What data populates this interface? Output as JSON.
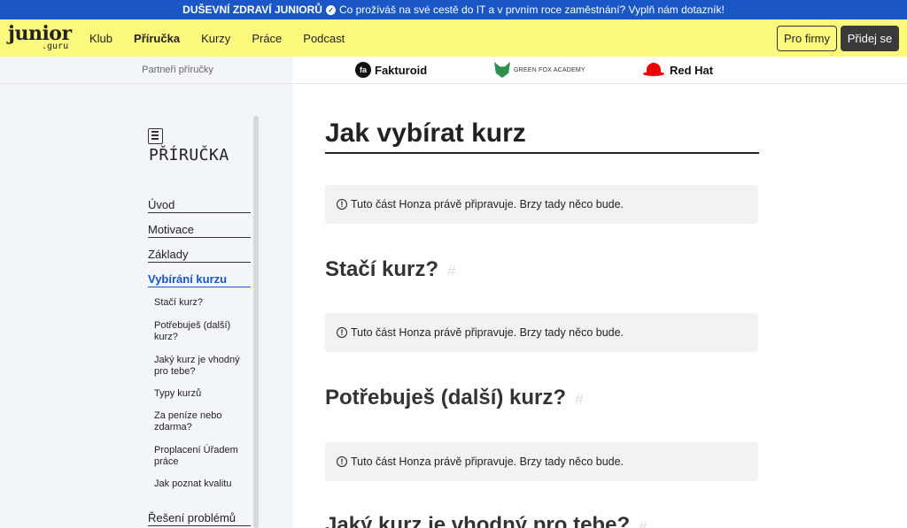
{
  "banner": {
    "bold": "DUŠEVNÍ ZDRAVÍ JUNIORŮ",
    "text": "Co prožíváš na své cestě do IT a v prvním roce zaměstnání? Vyplň nám dotazník!"
  },
  "logo": {
    "line1": "junior",
    "line2": ".guru"
  },
  "nav": {
    "items": [
      "Klub",
      "Příručka",
      "Kurzy",
      "Práce",
      "Podcast"
    ],
    "for_companies": "Pro firmy",
    "join": "Přidej se"
  },
  "partners": {
    "label": "Partneři příručky",
    "fakturoid": "Fakturoid",
    "fakturoid_mark": "fa",
    "greenfox": "GREEN FOX ACADEMY",
    "redhat": "Red Hat"
  },
  "sidebar": {
    "title": "PŘÍRUČKA",
    "items": [
      "Úvod",
      "Motivace",
      "Základy",
      "Vybírání kurzu"
    ],
    "subitems": [
      "Stačí kurz?",
      "Potřebuješ (další) kurz?",
      "Jaký kurz je vhodný pro tebe?",
      "Typy kurzů",
      "Za peníze nebo zdarma?",
      "Proplacení Úřadem práce",
      "Jak poznat kvalitu"
    ],
    "last_item": "Řešení problémů"
  },
  "main": {
    "title": "Jak vybírat kurz",
    "notice": "Tuto část Honza právě připravuje. Brzy tady něco bude.",
    "sections": [
      "Stačí kurz?",
      "Potřebuješ (další) kurz?",
      "Jaký kurz je vhodný pro tebe?"
    ],
    "hash": "#"
  }
}
